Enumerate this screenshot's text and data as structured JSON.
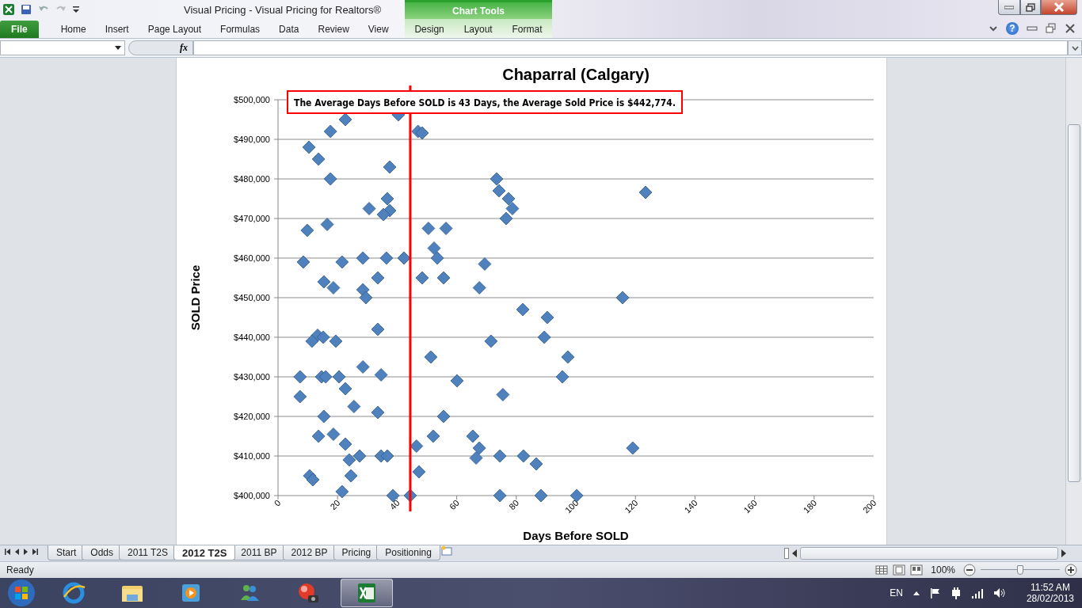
{
  "window": {
    "title": "Visual Pricing  -  Visual Pricing for Realtors®",
    "context_group": "Chart Tools"
  },
  "ribbon_tabs": [
    {
      "label": "File",
      "kind": "file"
    },
    {
      "label": "Home",
      "kind": "main"
    },
    {
      "label": "Insert",
      "kind": "main"
    },
    {
      "label": "Page Layout",
      "kind": "main"
    },
    {
      "label": "Formulas",
      "kind": "main"
    },
    {
      "label": "Data",
      "kind": "main"
    },
    {
      "label": "Review",
      "kind": "main"
    },
    {
      "label": "View",
      "kind": "main"
    },
    {
      "label": "Design",
      "kind": "context"
    },
    {
      "label": "Layout",
      "kind": "context"
    },
    {
      "label": "Format",
      "kind": "context"
    }
  ],
  "help_glyph": "?",
  "formula_bar": {
    "fx_label": "fx"
  },
  "chart": {
    "chart_data": {
      "type": "scatter",
      "title": "Chaparral (Calgary)",
      "xlabel": "Days Before SOLD",
      "ylabel": "SOLD Price",
      "xlim": [
        0,
        200
      ],
      "ylim": [
        400000,
        500000
      ],
      "xticks": [
        0,
        20,
        40,
        60,
        80,
        100,
        120,
        140,
        160,
        180,
        200
      ],
      "yticks": [
        {
          "value": 400000,
          "label": "$400,000"
        },
        {
          "value": 410000,
          "label": "$410,000"
        },
        {
          "value": 420000,
          "label": "$420,000"
        },
        {
          "value": 430000,
          "label": "$430,000"
        },
        {
          "value": 440000,
          "label": "$440,000"
        },
        {
          "value": 450000,
          "label": "$450,000"
        },
        {
          "value": 460000,
          "label": "$460,000"
        },
        {
          "value": 470000,
          "label": "$470,000"
        },
        {
          "value": 480000,
          "label": "$480,000"
        },
        {
          "value": 490000,
          "label": "$490,000"
        },
        {
          "value": 500000,
          "label": "$500,000"
        }
      ],
      "x": [
        22.6,
        17.6,
        40.4,
        47,
        48.4,
        10.4,
        13.6,
        37.5,
        17.6,
        73.4,
        74.2,
        77.4,
        123.4,
        36.7,
        78.7,
        30.6,
        37.5,
        35.4,
        76.6,
        16.5,
        9.8,
        50.5,
        56.4,
        52.4,
        8.5,
        21.5,
        28.5,
        36.4,
        42.3,
        53.5,
        69.4,
        15.4,
        33.5,
        48.4,
        55.6,
        18.6,
        28.5,
        29.5,
        67.6,
        115.7,
        82.2,
        90.4,
        33.5,
        13.3,
        15.2,
        11.4,
        19.4,
        89.4,
        71.5,
        51.3,
        97.3,
        7.4,
        14.6,
        16,
        20.5,
        28.5,
        34.6,
        60.1,
        95.5,
        22.6,
        75.5,
        7.4,
        25.5,
        33.5,
        15.4,
        55.6,
        13.6,
        18.6,
        52.1,
        65.4,
        22.6,
        67.6,
        46.5,
        119.1,
        27.4,
        34.6,
        36.7,
        74.5,
        82.4,
        66.5,
        23.9,
        86.7,
        47.3,
        10.6,
        24.5,
        11.7,
        21.5,
        38.6,
        44.4,
        74.5,
        88.3,
        100.3
      ],
      "grid": true,
      "series": [
        {
          "color": "#4f81bd",
          "values": [
            495000,
            492000,
            496200,
            492000,
            491600,
            488000,
            485000,
            483000,
            480000,
            480000,
            477000,
            475000,
            476600,
            475000,
            472500,
            472500,
            472000,
            471000,
            470000,
            468500,
            467000,
            467500,
            467500,
            462500,
            459000,
            459000,
            460000,
            460000,
            460000,
            460000,
            458500,
            454000,
            455000,
            455000,
            455000,
            452500,
            452000,
            450000,
            452500,
            450000,
            447000,
            445000,
            442000,
            440500,
            440000,
            439000,
            439000,
            440000,
            439000,
            435000,
            435000,
            430000,
            430000,
            430000,
            430000,
            432500,
            430500,
            429000,
            430000,
            427000,
            425500,
            425000,
            422500,
            421000,
            420000,
            420000,
            415000,
            415500,
            415000,
            415000,
            413000,
            412000,
            412500,
            412000,
            410000,
            410000,
            410000,
            410000,
            410000,
            409500,
            409000,
            408000,
            406000,
            405000,
            405000,
            404000,
            401000,
            400000,
            400000,
            400000,
            400000,
            400000
          ]
        }
      ],
      "ref_lines": [
        {
          "axis": "x",
          "value": 44.4,
          "color": "#ff0000"
        }
      ],
      "annotations": [
        {
          "text": "The Average Days Before SOLD is 43 Days, the Average Sold Price is $442,774."
        }
      ]
    }
  },
  "sheet_tabs": [
    {
      "label": "Start",
      "selected": false
    },
    {
      "label": "Odds",
      "selected": false
    },
    {
      "label": "2011 T2S",
      "selected": false
    },
    {
      "label": "2012 T2S",
      "selected": true
    },
    {
      "label": "2011 BP",
      "selected": false
    },
    {
      "label": "2012 BP",
      "selected": false
    },
    {
      "label": "Pricing",
      "selected": false
    },
    {
      "label": "Positioning",
      "selected": false
    }
  ],
  "status_bar": {
    "status": "Ready",
    "zoom": "100%",
    "zoom_slider": {
      "level": 0.5
    }
  },
  "taskbar": {
    "apps": [
      {
        "kind": "browser",
        "active": false
      },
      {
        "kind": "folder",
        "active": false
      },
      {
        "kind": "media",
        "active": false
      },
      {
        "kind": "messenger",
        "active": false
      },
      {
        "kind": "camera",
        "active": false
      },
      {
        "kind": "spreadsheet",
        "active": true
      }
    ],
    "language": "EN",
    "time": "11:52 AM",
    "date": "28/02/2013"
  }
}
